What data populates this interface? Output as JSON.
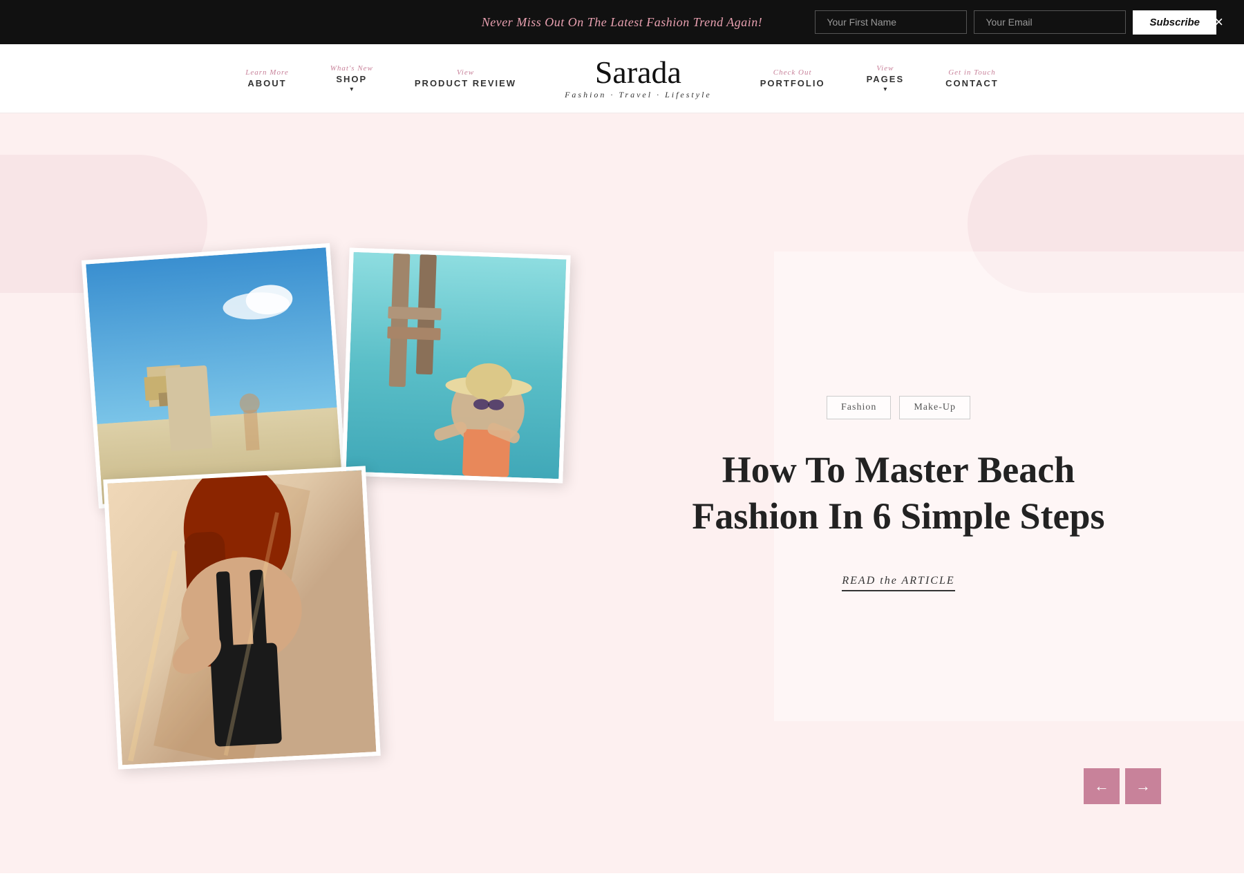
{
  "banner": {
    "text": "Never Miss Out On The Latest Fashion Trend Again!",
    "first_name_placeholder": "Your First Name",
    "email_placeholder": "Your Email",
    "subscribe_label": "Subscribe",
    "close_label": "×"
  },
  "nav": {
    "items": [
      {
        "label": "Learn More",
        "main": "ABOUT",
        "has_arrow": false
      },
      {
        "label": "What's New",
        "main": "SHOP",
        "has_arrow": true
      },
      {
        "label": "View",
        "main": "PRODUCT REVIEW",
        "has_arrow": false
      }
    ],
    "logo": {
      "text": "Sarada",
      "tagline": "Fashion · Travel · Lifestyle"
    },
    "items_right": [
      {
        "label": "Check Out",
        "main": "PORTFOLIO",
        "has_arrow": false
      },
      {
        "label": "View",
        "main": "PAGES",
        "has_arrow": true
      },
      {
        "label": "Get in Touch",
        "main": "CONTACT",
        "has_arrow": false
      }
    ]
  },
  "hero": {
    "tags": [
      "Fashion",
      "Make-Up"
    ],
    "title": "How To Master Beach Fashion In 6 Simple Steps",
    "read_link": "READ the ARTICLE",
    "prev_label": "←",
    "next_label": "→"
  }
}
